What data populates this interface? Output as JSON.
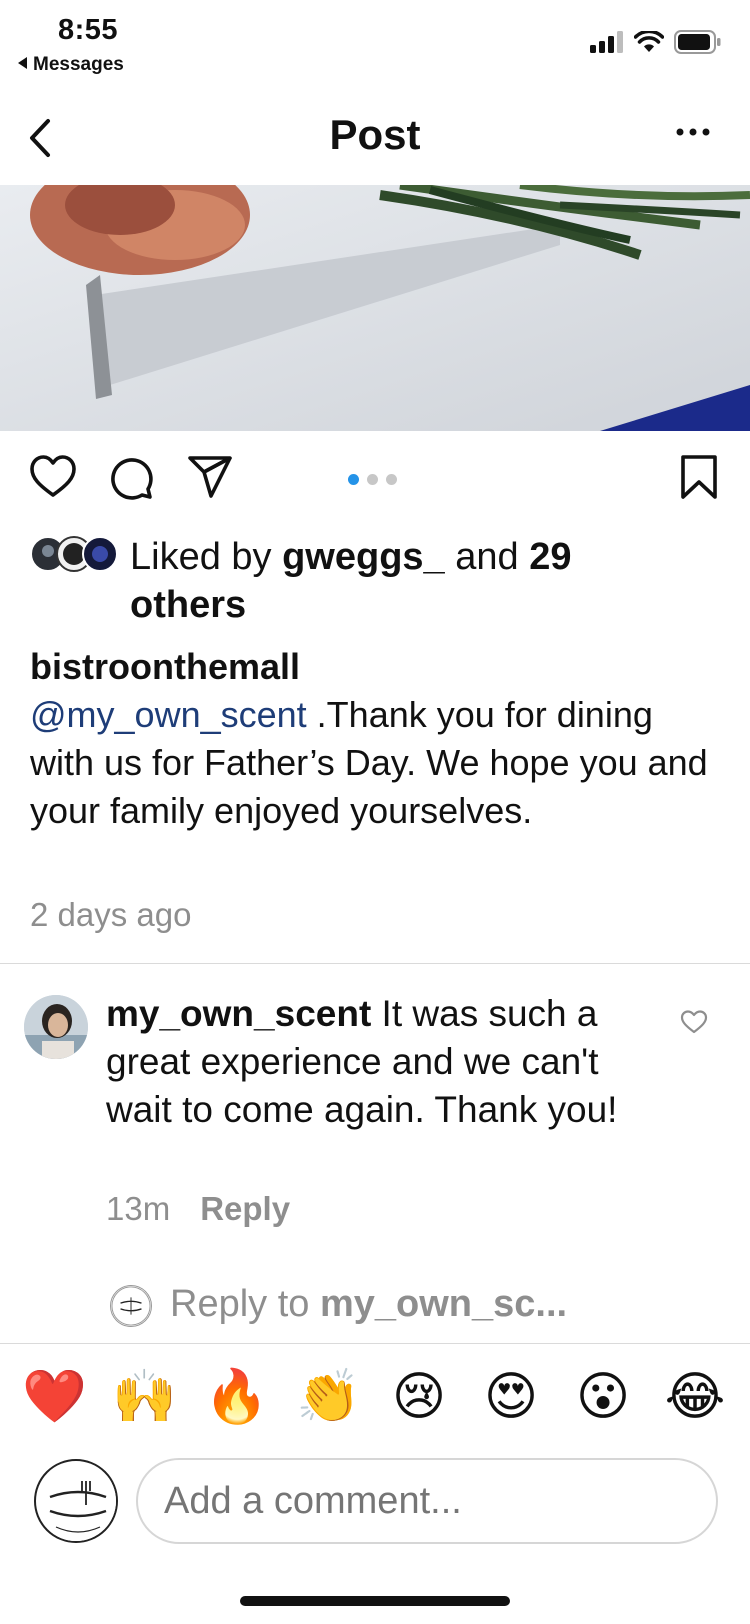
{
  "status_bar": {
    "time": "8:55",
    "back_app": "Messages",
    "icons": [
      "signal-icon",
      "wifi-icon",
      "battery-icon"
    ]
  },
  "nav": {
    "title": "Post",
    "back_icon": "chevron-left-icon",
    "more_icon": "more-dots-icon"
  },
  "post": {
    "carousel": {
      "count": 3,
      "active_index": 0
    },
    "likes": {
      "prefix": "Liked by ",
      "user": "gweggs_",
      "middle": " and ",
      "count": "29",
      "suffix": "others"
    },
    "caption": {
      "user": "bistroonthemall",
      "mention": "@my_own_scent",
      "text": " .Thank you for dining with us for Father’s Day. We hope you and your family enjoyed yourselves."
    },
    "time_ago": "2 days ago"
  },
  "comments": [
    {
      "user": "my_own_scent",
      "text": " It was such a great experience and we can't wait to come again. Thank you!",
      "time": "13m",
      "reply_label": "Reply"
    }
  ],
  "reply_to": {
    "prefix": "Reply to ",
    "user": "my_own_sc..."
  },
  "emojis": [
    "❤️",
    "🙌",
    "🔥",
    "👏",
    "😢",
    "😍",
    "😮",
    "😂"
  ],
  "comment_input": {
    "placeholder": "Add a comment..."
  },
  "colors": {
    "accent_blue": "#2493e8",
    "mention_blue": "#1e3d78",
    "secondary_text": "#8e8e8e"
  }
}
